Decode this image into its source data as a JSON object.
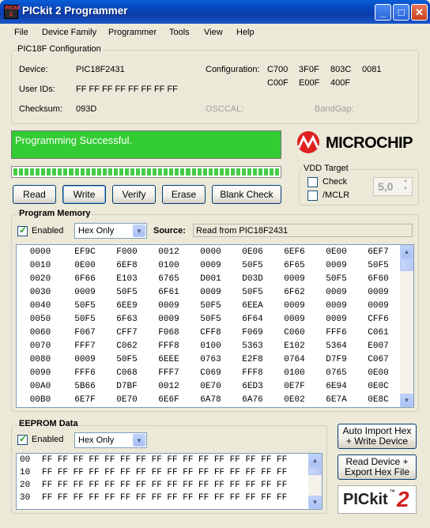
{
  "window": {
    "title": "PICkit 2 Programmer",
    "app_icon_text": "PICkit 2",
    "minimize": "_",
    "maximize": "□",
    "close": "✕"
  },
  "menu": [
    "File",
    "Device Family",
    "Programmer",
    "Tools",
    "View",
    "Help"
  ],
  "config": {
    "group_title": "PIC18F Configuration",
    "device_label": "Device:",
    "device_value": "PIC18F2431",
    "userids_label": "User IDs:",
    "userids_value": "FF FF FF FF FF FF FF FF",
    "checksum_label": "Checksum:",
    "checksum_value": "093D",
    "configuration_label": "Configuration:",
    "configuration_words": [
      "C700",
      "3F0F",
      "803C",
      "0081",
      "C00F",
      "E00F",
      "400F"
    ],
    "osccal_label": "OSCCAL:",
    "bandgap_label": "BandGap:"
  },
  "status": {
    "message": "Programming Successful.",
    "color": "#33cc33",
    "progress": 1.0
  },
  "logo": {
    "text": "MICROCHIP"
  },
  "vdd": {
    "group_title": "VDD Target",
    "check_label": "Check",
    "mclr_label": "/MCLR",
    "value": "5,0"
  },
  "actions": {
    "read": "Read",
    "write": "Write",
    "verify": "Verify",
    "erase": "Erase",
    "blank_check": "Blank Check"
  },
  "program_memory": {
    "title": "Program Memory",
    "enabled_label": "Enabled",
    "view_mode": "Hex Only",
    "source_label": "Source:",
    "source_value": "Read from PIC18F2431",
    "rows": [
      [
        "0000",
        "EF9C",
        "F000",
        "0012",
        "0000",
        "0E06",
        "6EF6",
        "0E00",
        "6EF7"
      ],
      [
        "0010",
        "0E00",
        "6EF8",
        "0100",
        "0009",
        "50F5",
        "6F65",
        "0009",
        "50F5"
      ],
      [
        "0020",
        "6F66",
        "E103",
        "6765",
        "D001",
        "D03D",
        "0009",
        "50F5",
        "6F60"
      ],
      [
        "0030",
        "0009",
        "50F5",
        "6F61",
        "0009",
        "50F5",
        "6F62",
        "0009",
        "0009"
      ],
      [
        "0040",
        "50F5",
        "6EE9",
        "0009",
        "50F5",
        "6EEA",
        "0009",
        "0009",
        "0009"
      ],
      [
        "0050",
        "50F5",
        "6F63",
        "0009",
        "50F5",
        "6F64",
        "0009",
        "0009",
        "CFF6"
      ],
      [
        "0060",
        "F067",
        "CFF7",
        "F068",
        "CFF8",
        "F069",
        "C060",
        "FFF6",
        "C061"
      ],
      [
        "0070",
        "FFF7",
        "C062",
        "FFF8",
        "0100",
        "5363",
        "E102",
        "5364",
        "E007"
      ],
      [
        "0080",
        "0009",
        "50F5",
        "6EEE",
        "0763",
        "E2F8",
        "0764",
        "D7F9",
        "C067"
      ],
      [
        "0090",
        "FFF6",
        "C068",
        "FFF7",
        "C069",
        "FFF8",
        "0100",
        "0765",
        "0E00"
      ],
      [
        "00A0",
        "5B66",
        "D7BF",
        "0012",
        "0E70",
        "6ED3",
        "0E7F",
        "6E94",
        "0E0C"
      ],
      [
        "00B0",
        "6E7F",
        "0E70",
        "6E6F",
        "6A78",
        "6A76",
        "0E02",
        "6E7A",
        "0E8C"
      ]
    ]
  },
  "eeprom": {
    "title": "EEPROM Data",
    "enabled_label": "Enabled",
    "view_mode": "Hex Only",
    "rows": [
      [
        "00",
        "FF FF FF FF FF FF FF FF FF FF FF FF FF FF FF FF"
      ],
      [
        "10",
        "FF FF FF FF FF FF FF FF FF FF FF FF FF FF FF FF"
      ],
      [
        "20",
        "FF FF FF FF FF FF FF FF FF FF FF FF FF FF FF FF"
      ],
      [
        "30",
        "FF FF FF FF FF FF FF FF FF FF FF FF FF FF FF FF"
      ]
    ]
  },
  "side_buttons": {
    "auto_import": [
      "Auto Import Hex",
      "+ Write Device"
    ],
    "read_export": [
      "Read Device +",
      "Export Hex File"
    ]
  },
  "brand": {
    "text": "PICkit",
    "tm": "™",
    "number": "2"
  }
}
